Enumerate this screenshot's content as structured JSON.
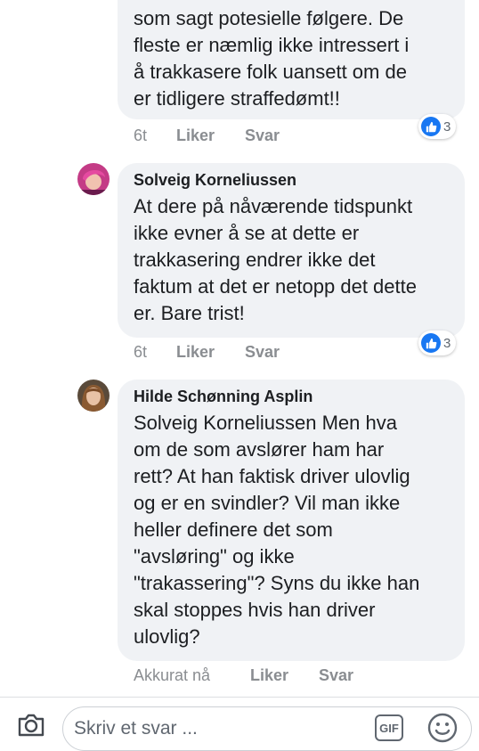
{
  "comments": [
    {
      "author": "",
      "lines": [
        "som sagt potesielle følgere. De",
        "fleste er næmlig ikke intressert i",
        "å trakkasere folk uansett om de",
        "er tidligere straffedømt!!"
      ],
      "time": "6t",
      "like_label": "Liker",
      "reply_label": "Svar",
      "reaction_count": "3"
    },
    {
      "author": "Solveig Korneliussen",
      "lines": [
        "At dere på nåværende tidspunkt",
        "ikke evner å se at dette er",
        "trakkasering endrer ikke det",
        "faktum at det er netopp det dette",
        "er. Bare trist!"
      ],
      "time": "6t",
      "like_label": "Liker",
      "reply_label": "Svar",
      "reaction_count": "3"
    },
    {
      "author": "Hilde Schønning Asplin",
      "lines": [
        "Solveig Korneliussen Men hva",
        "om de som avslører ham har",
        "rett? At han faktisk driver ulovlig",
        "og er en svindler? Vil man ikke",
        "heller definere det som",
        "\"avsløring\" og ikke",
        "\"trakassering\"? Syns du ikke han",
        "skal stoppes hvis han driver",
        "ulovlig?"
      ],
      "time": "Akkurat nå",
      "like_label": "Liker",
      "reply_label": "Svar"
    }
  ],
  "composer": {
    "placeholder": "Skriv et svar ...",
    "gif_label": "GIF",
    "icons": [
      "camera-icon",
      "gif-icon",
      "emoji-icon"
    ]
  },
  "colors": {
    "bubble": "#f0f2f5",
    "like_blue": "#1877f2",
    "meta_gray": "#8a8d91"
  }
}
